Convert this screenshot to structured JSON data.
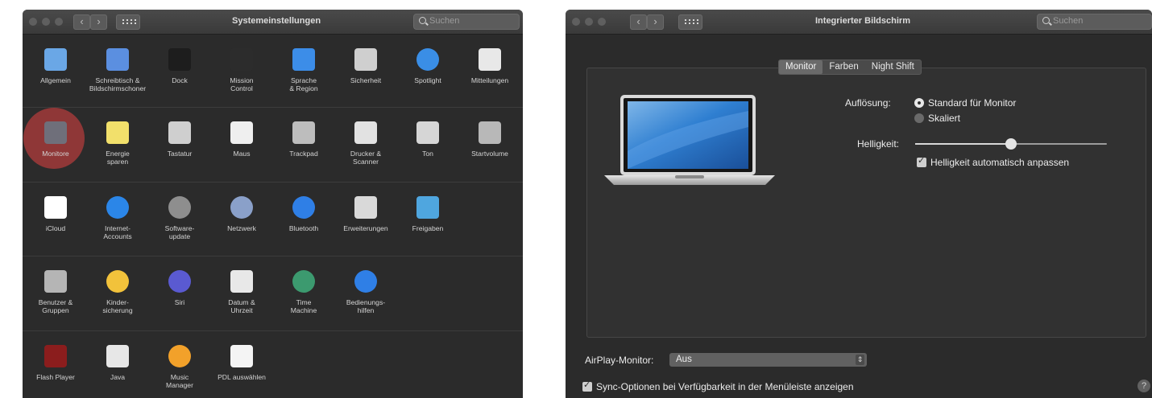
{
  "left_window": {
    "title": "Systemeinstellungen",
    "search_placeholder": "Suchen",
    "rows": [
      [
        {
          "label": "Allgemein",
          "icon": "general-icon",
          "color": "#6aa7e6"
        },
        {
          "label": "Schreibtisch &\nBildschirmschoner",
          "icon": "desktop-screensaver-icon",
          "color": "#5b8fe0"
        },
        {
          "label": "Dock",
          "icon": "dock-icon",
          "color": "#1d1d1d"
        },
        {
          "label": "Mission\nControl",
          "icon": "mission-control-icon",
          "color": "#2c2c2c"
        },
        {
          "label": "Sprache\n& Region",
          "icon": "language-region-icon",
          "color": "#3c8de8"
        },
        {
          "label": "Sicherheit",
          "icon": "security-icon",
          "color": "#cfcfcf"
        },
        {
          "label": "Spotlight",
          "icon": "spotlight-icon",
          "color": "#3a8ee6"
        },
        {
          "label": "Mitteilungen",
          "icon": "notifications-icon",
          "color": "#e8e8e8"
        }
      ],
      [
        {
          "label": "Monitore",
          "icon": "displays-icon",
          "color": "#6f6f7a"
        },
        {
          "label": "Energie\nsparen",
          "icon": "energy-saver-icon",
          "color": "#f2e06b"
        },
        {
          "label": "Tastatur",
          "icon": "keyboard-icon",
          "color": "#cfcfcf"
        },
        {
          "label": "Maus",
          "icon": "mouse-icon",
          "color": "#efefef"
        },
        {
          "label": "Trackpad",
          "icon": "trackpad-icon",
          "color": "#bdbdbd"
        },
        {
          "label": "Drucker &\nScanner",
          "icon": "printer-scanner-icon",
          "color": "#e2e2e2"
        },
        {
          "label": "Ton",
          "icon": "sound-icon",
          "color": "#d6d6d6"
        },
        {
          "label": "Startvolume",
          "icon": "startup-disk-icon",
          "color": "#b8b8b8"
        }
      ],
      [
        {
          "label": "iCloud",
          "icon": "icloud-icon",
          "color": "#ffffff"
        },
        {
          "label": "Internet-\nAccounts",
          "icon": "internet-accounts-icon",
          "color": "#2b86e8"
        },
        {
          "label": "Software-\nupdate",
          "icon": "software-update-icon",
          "color": "#8e8e8e"
        },
        {
          "label": "Netzwerk",
          "icon": "network-icon",
          "color": "#8aa0c9"
        },
        {
          "label": "Bluetooth",
          "icon": "bluetooth-icon",
          "color": "#2f7fe6"
        },
        {
          "label": "Erweiterungen",
          "icon": "extensions-icon",
          "color": "#d9d9d9"
        },
        {
          "label": "Freigaben",
          "icon": "sharing-icon",
          "color": "#4fa6df"
        }
      ],
      [
        {
          "label": "Benutzer &\nGruppen",
          "icon": "users-groups-icon",
          "color": "#b5b5b5"
        },
        {
          "label": "Kinder-\nsicherung",
          "icon": "parental-controls-icon",
          "color": "#f2c23b"
        },
        {
          "label": "Siri",
          "icon": "siri-icon",
          "color": "#5a5ad1"
        },
        {
          "label": "Datum &\nUhrzeit",
          "icon": "date-time-icon",
          "color": "#e8e8e8"
        },
        {
          "label": "Time\nMachine",
          "icon": "time-machine-icon",
          "color": "#3c9a6f"
        },
        {
          "label": "Bedienungs-\nhilfen",
          "icon": "accessibility-icon",
          "color": "#2f7fe6"
        }
      ],
      [
        {
          "label": "Flash Player",
          "icon": "flash-player-icon",
          "color": "#8b1d1d"
        },
        {
          "label": "Java",
          "icon": "java-icon",
          "color": "#e7e7e7"
        },
        {
          "label": "Music\nManager",
          "icon": "music-manager-icon",
          "color": "#f2a12a"
        },
        {
          "label": "PDL auswählen",
          "icon": "pdl-icon",
          "color": "#f4f4f4"
        }
      ]
    ]
  },
  "right_window": {
    "title": "Integrierter Bildschirm",
    "search_placeholder": "Suchen",
    "tabs": [
      "Monitor",
      "Farben",
      "Night Shift"
    ],
    "active_tab": "Monitor",
    "resolution_label": "Auflösung:",
    "resolution_options": [
      "Standard für Monitor",
      "Skaliert"
    ],
    "resolution_selected": "Standard für Monitor",
    "brightness_label": "Helligkeit:",
    "brightness_value": 0.5,
    "auto_brightness_label": "Helligkeit automatisch anpassen",
    "auto_brightness_checked": true,
    "airplay_label": "AirPlay-Monitor:",
    "airplay_value": "Aus",
    "sync_label": "Sync-Optionen bei Verfügbarkeit in der Menüleiste anzeigen",
    "sync_checked": true,
    "help_label": "?"
  }
}
